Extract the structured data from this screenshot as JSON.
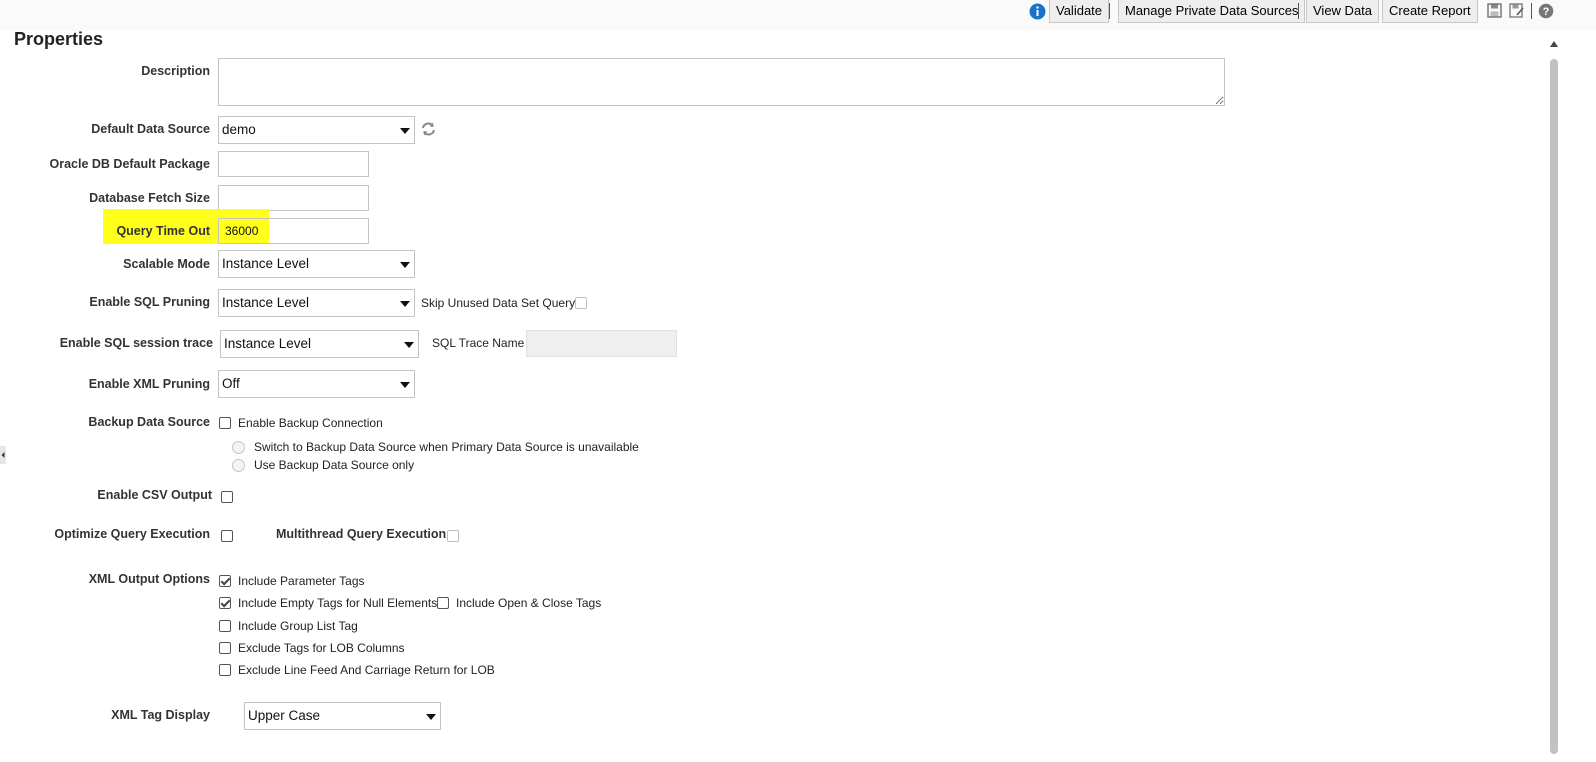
{
  "toolbar": {
    "validate_label": "Validate",
    "manage_label": "Manage Private Data Sources",
    "view_data_label": "View Data",
    "create_report_label": "Create Report"
  },
  "page_title": "Properties",
  "fields": {
    "description_label": "Description",
    "description_value": "",
    "default_data_source_label": "Default Data Source",
    "default_data_source_value": "demo",
    "oracle_pkg_label": "Oracle DB Default Package",
    "oracle_pkg_value": "",
    "fetch_size_label": "Database Fetch Size",
    "fetch_size_value": "",
    "query_timeout_label": "Query Time Out",
    "query_timeout_value": "36000",
    "scalable_mode_label": "Scalable Mode",
    "scalable_mode_value": "Instance Level",
    "sql_pruning_label": "Enable SQL Pruning",
    "sql_pruning_value": "Instance Level",
    "skip_unused_label": "Skip Unused Data Set Query",
    "sql_trace_label": "Enable SQL session trace",
    "sql_trace_value": "Instance Level",
    "sql_trace_name_label": "SQL Trace Name",
    "sql_trace_name_value": "",
    "xml_pruning_label": "Enable XML Pruning",
    "xml_pruning_value": "Off",
    "backup_label": "Backup Data Source",
    "enable_backup_label": "Enable Backup Connection",
    "switch_backup_label": "Switch to Backup Data Source when Primary Data Source is unavailable",
    "use_backup_label": "Use Backup Data Source only",
    "csv_label": "Enable CSV Output",
    "optimize_label": "Optimize Query Execution",
    "multithread_label": "Multithread Query Execution",
    "xml_output_label": "XML Output Options",
    "include_param_tags": "Include Parameter Tags",
    "include_empty_tags": "Include Empty Tags for Null Elements",
    "include_open_close": "Include Open & Close Tags",
    "include_group_list": "Include Group List Tag",
    "exclude_lob_tags": "Exclude Tags for LOB Columns",
    "exclude_line_feed": "Exclude Line Feed And Carriage Return for LOB",
    "xml_tag_display_label": "XML Tag Display",
    "xml_tag_display_value": "Upper Case"
  },
  "colors": {
    "highlight": "#ffff1a",
    "info_icon": "#1a73c7"
  }
}
